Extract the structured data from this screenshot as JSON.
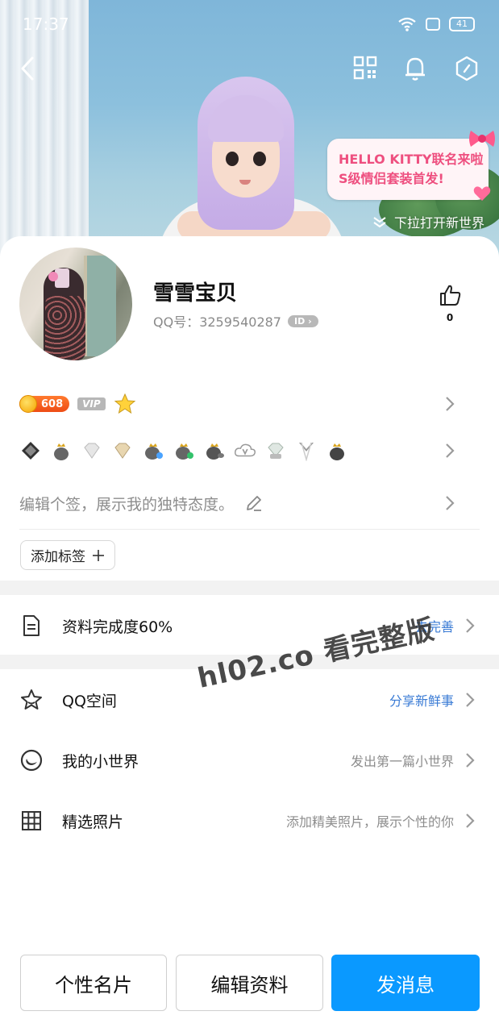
{
  "status_bar": {
    "time": "17:37",
    "battery": "41"
  },
  "banner": {
    "promo_line1": "HELLO KITTY联名来啦",
    "promo_line2": "S级情侣套装首发!",
    "pull_hint": "下拉打开新世界",
    "icons": [
      "back-icon",
      "qr-code-icon",
      "bell-icon",
      "hexagon-icon"
    ]
  },
  "profile": {
    "name": "雪雪宝贝",
    "qq_number": "QQ号：3259540287",
    "id_badge": "ID",
    "likes": "0"
  },
  "badges": {
    "coin_value": "608",
    "vip_label": "VIP"
  },
  "signature": {
    "placeholder": "编辑个签，展示我的独特态度。"
  },
  "tag_button": {
    "label": "添加标签"
  },
  "completeness": {
    "title": "资料完成度60%",
    "action": "去完善"
  },
  "list": [
    {
      "title": "QQ空间",
      "sub": "分享新鲜事"
    },
    {
      "title": "我的小世界",
      "sub": "发出第一篇小世界"
    },
    {
      "title": "精选照片",
      "sub": "添加精美照片，展示个性的你"
    }
  ],
  "watermark": "hl02.co 看完整版",
  "bottom": {
    "card_btn": "个性名片",
    "edit_btn": "编辑资料",
    "message_btn": "发消息"
  },
  "colors": {
    "primary": "#0a99ff",
    "link": "#3a7bd5",
    "coin_badge": "#ee4c15"
  }
}
